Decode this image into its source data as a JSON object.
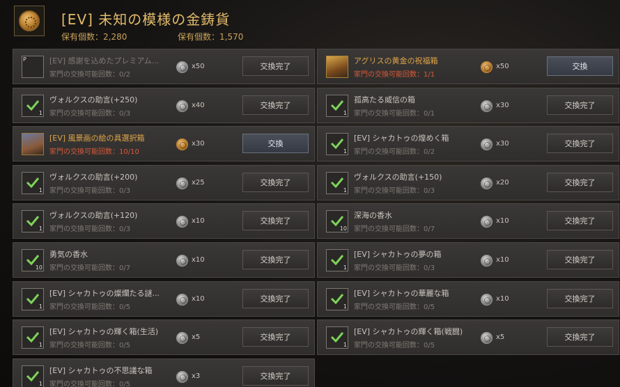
{
  "header": {
    "title": "[EV] 未知の模様の金鋳貨",
    "owned_a": "保有個数：2,280",
    "owned_b": "保有個数：1,570"
  },
  "left_items": [
    {
      "name": "[EV] 感謝を込めたプレミアム...",
      "sub": "家門の交換可能回数：0/2",
      "price": "x50",
      "button": "交換完了",
      "icon": "premium-box-icon",
      "state": "done",
      "badge": "P",
      "coin": "silver"
    },
    {
      "name": "ヴォルクスの助言(+250)",
      "sub": "家門の交換可能回数：0/3",
      "price": "x40",
      "button": "交換完了",
      "icon": "check-icon",
      "state": "done",
      "qty": "1",
      "coin": "silver"
    },
    {
      "name": "[EV] 風景画の絵の具選択箱",
      "sub": "家門の交換可能回数：10/10",
      "price": "x30",
      "button": "交換",
      "icon": "paint-box-icon",
      "state": "available",
      "coin": "gold"
    },
    {
      "name": "ヴォルクスの助言(+200)",
      "sub": "家門の交換可能回数：0/3",
      "price": "x25",
      "button": "交換完了",
      "icon": "check-icon",
      "state": "done",
      "qty": "1",
      "coin": "silver"
    },
    {
      "name": "ヴォルクスの助言(+120)",
      "sub": "家門の交換可能回数：0/3",
      "price": "x10",
      "button": "交換完了",
      "icon": "check-icon",
      "state": "done",
      "qty": "1",
      "coin": "silver"
    },
    {
      "name": "勇気の香水",
      "sub": "家門の交換可能回数：0/7",
      "price": "x10",
      "button": "交換完了",
      "icon": "check-icon",
      "state": "done",
      "qty": "10",
      "coin": "silver"
    },
    {
      "name": "[EV] シャカトゥの燦爛たる謎...",
      "sub": "家門の交換可能回数：0/5",
      "price": "x10",
      "button": "交換完了",
      "icon": "check-icon",
      "state": "done",
      "qty": "1",
      "coin": "silver"
    },
    {
      "name": "[EV] シャカトゥの輝く箱(生活)",
      "sub": "家門の交換可能回数：0/5",
      "price": "x5",
      "button": "交換完了",
      "icon": "check-icon",
      "state": "done",
      "qty": "1",
      "coin": "silver"
    },
    {
      "name": "[EV] シャカトゥの不思議な箱",
      "sub": "家門の交換可能回数：0/5",
      "price": "x3",
      "button": "交換完了",
      "icon": "check-icon",
      "state": "done",
      "qty": "1",
      "coin": "silver"
    }
  ],
  "right_items": [
    {
      "name": "アグリスの黄金の祝福箱",
      "sub": "家門の交換可能回数：1/1",
      "price": "x50",
      "button": "交換",
      "icon": "golden-box-icon",
      "state": "available",
      "coin": "gold"
    },
    {
      "name": "孤高たる威信の箱",
      "sub": "家門の交換可能回数：0/1",
      "price": "x30",
      "button": "交換完了",
      "icon": "check-icon",
      "state": "done",
      "qty": "1",
      "coin": "silver"
    },
    {
      "name": "[EV] シャカトゥの煌めく箱",
      "sub": "家門の交換可能回数：0/2",
      "price": "x30",
      "button": "交換完了",
      "icon": "check-icon",
      "state": "done",
      "qty": "1",
      "coin": "silver"
    },
    {
      "name": "ヴォルクスの助言(+150)",
      "sub": "家門の交換可能回数：0/3",
      "price": "x20",
      "button": "交換完了",
      "icon": "check-icon",
      "state": "done",
      "qty": "1",
      "coin": "silver"
    },
    {
      "name": "深海の香水",
      "sub": "家門の交換可能回数：0/7",
      "price": "x10",
      "button": "交換完了",
      "icon": "check-icon",
      "state": "done",
      "qty": "10",
      "coin": "silver"
    },
    {
      "name": "[EV] シャカトゥの夢の箱",
      "sub": "家門の交換可能回数：0/3",
      "price": "x10",
      "button": "交換完了",
      "icon": "check-icon",
      "state": "done",
      "qty": "1",
      "coin": "silver"
    },
    {
      "name": "[EV] シャカトゥの華麗な箱",
      "sub": "家門の交換可能回数：0/5",
      "price": "x10",
      "button": "交換完了",
      "icon": "check-icon",
      "state": "done",
      "qty": "1",
      "coin": "silver"
    },
    {
      "name": "[EV] シャカトゥの輝く箱(戦闘)",
      "sub": "家門の交換可能回数：0/5",
      "price": "x5",
      "button": "交換完了",
      "icon": "check-icon",
      "state": "done",
      "qty": "1",
      "coin": "silver"
    }
  ],
  "colors": {
    "title": "#e3bb6a",
    "highlight_name": "#e0a54a",
    "available_count": "#d85a3a",
    "check": "#7ed35a"
  }
}
